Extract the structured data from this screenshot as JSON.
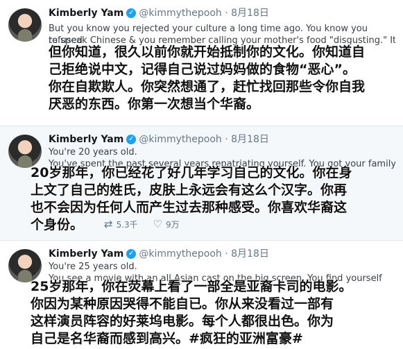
{
  "tweets": [
    {
      "name": "Kimberly Yam",
      "handle": "@kimmythepooh",
      "separator": "·",
      "date": "8月18日",
      "english_lines": [
        "But you know you rejected your culture a long time ago. You know you refused",
        "to speak Chinese & you remember calling your mother's food \"disgusting.\" It's"
      ],
      "chinese_lines": [
        "但你知道，很久以前你就开始抵制你的文化。你知道自",
        "己拒绝说中文，记得自己说过妈妈做的食物“恶心”。",
        "你在自欺欺人。你突然想通了，赶忙找回那些令你自我",
        "厌恶的东西。你第一次想当个华裔。"
      ]
    },
    {
      "name": "Kimberly Yam",
      "handle": "@kimmythepooh",
      "separator": "·",
      "date": "8月18日",
      "english_lines": [
        "You're 20 years old.",
        "You've spent the past several years repatriating yourself. You got your family's"
      ],
      "chinese_lines": [
        "20岁那年，你已经花了好几年学习自己的文化。你在身",
        "上文了自己的姓氏，皮肤上永远会有这么个汉字。你再",
        "也不会因为任何人而产生过去那种感受。你喜欢华裔这",
        "个身份。"
      ],
      "actions": {
        "retweets": "5.3千",
        "likes": "9万"
      }
    },
    {
      "name": "Kimberly Yam",
      "handle": "@kimmythepooh",
      "separator": "·",
      "date": "8月18日",
      "english_lines": [
        "You're 25 years old.",
        "You see a movie with an all Asian cast on the big screen. You find yourself"
      ],
      "chinese_lines": [
        "25岁那年，你在荧幕上看了一部全是亚裔卡司的电影。",
        "你因为某种原因哭得不能自已。你从来没看过一部有",
        "这样演员阵容的好莱坞电影。每个人都很出色。你为",
        "自己是名华裔而感到高兴。#疯狂的亚洲富豪#"
      ]
    }
  ],
  "icons": {
    "verified": "verified-badge-icon",
    "retweet": "retweet-icon",
    "like": "heart-icon"
  },
  "colors": {
    "accent": "#1da1f2",
    "muted": "#657786",
    "alt_background": "#f5f8fa"
  }
}
